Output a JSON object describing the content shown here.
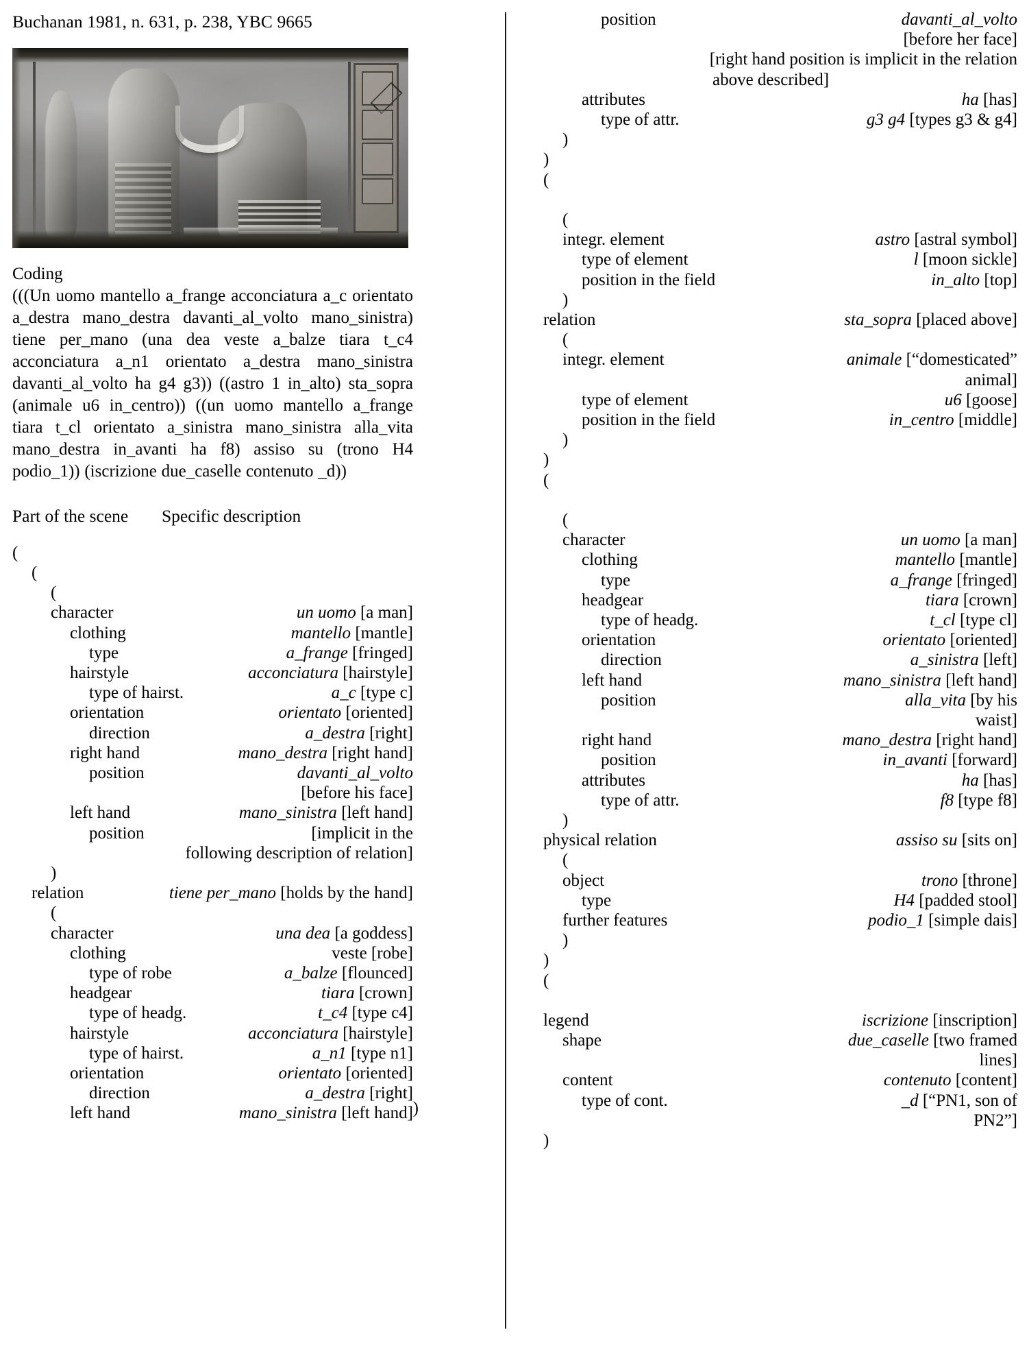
{
  "caption": "Buchanan 1981, n. 631, p. 238, YBC 9665",
  "figure": {
    "name": "cylinder-seal-impression"
  },
  "coding": {
    "heading": "Coding",
    "text": "(((Un uomo mantello a_frange acconciatura a_c orientato a_destra mano_destra davanti_al_volto mano_sinistra) tiene per_mano (una dea veste a_balze tiara t_c4 acconciatura a_n1 orientato a_destra mano_sinistra davanti_al_volto ha g4 g3)) ((astro 1 in_alto) sta_sopra (animale u6 in_centro)) ((un uomo mantello a_frange tiara t_cl orientato a_sinistra mano_sinistra alla_vita mano_destra in_avanti ha f8) assiso su (trono H4 podio_1)) (iscrizione due_caselle contenuto _d))"
  },
  "table_headers": {
    "part_of_scene": "Part of the scene",
    "specific_description": "Specific description"
  },
  "left_tree": [
    {
      "kind": "paren",
      "indent": 0,
      "text": "("
    },
    {
      "kind": "paren",
      "indent": 1,
      "text": "("
    },
    {
      "kind": "paren",
      "indent": 2,
      "text": "("
    },
    {
      "kind": "row",
      "indent": 2,
      "label": "character",
      "italic": "un uomo",
      "gloss": "[a man]"
    },
    {
      "kind": "row",
      "indent": 3,
      "label": "clothing",
      "italic": "mantello",
      "gloss": "[mantle]"
    },
    {
      "kind": "row",
      "indent": 4,
      "label": "type",
      "italic": "a_frange",
      "gloss": "[fringed]"
    },
    {
      "kind": "row",
      "indent": 3,
      "label": "hairstyle",
      "italic": "acconciatura",
      "gloss": "[hairstyle]"
    },
    {
      "kind": "row",
      "indent": 4,
      "label": "type of hairst.",
      "italic": "a_c",
      "gloss": "[type c]"
    },
    {
      "kind": "row",
      "indent": 3,
      "label": "orientation",
      "italic": "orientato",
      "gloss": "[oriented]"
    },
    {
      "kind": "row",
      "indent": 4,
      "label": "direction",
      "italic": "a_destra",
      "gloss": "[right]"
    },
    {
      "kind": "row",
      "indent": 3,
      "label": "right hand",
      "italic": "mano_destra",
      "gloss": "[right hand]"
    },
    {
      "kind": "row",
      "indent": 4,
      "label": "position",
      "italic": "davanti_al_volto",
      "gloss": ""
    },
    {
      "kind": "cont",
      "text": "[before his face]"
    },
    {
      "kind": "row",
      "indent": 3,
      "label": "left hand",
      "italic": "mano_sinistra",
      "gloss": "[left hand]"
    },
    {
      "kind": "row",
      "indent": 4,
      "label": "position",
      "italic": "",
      "gloss": "[implicit in the"
    },
    {
      "kind": "cont",
      "text": "following description of relation]"
    },
    {
      "kind": "paren",
      "indent": 2,
      "text": ")"
    },
    {
      "kind": "row",
      "indent": 1,
      "label": "relation",
      "italic": "tiene per_mano",
      "gloss": "[holds by the hand]"
    },
    {
      "kind": "paren",
      "indent": 2,
      "text": "("
    },
    {
      "kind": "row",
      "indent": 2,
      "label": "character",
      "italic": "una dea",
      "gloss": "[a goddess]"
    },
    {
      "kind": "row",
      "indent": 3,
      "label": "clothing",
      "italic": "",
      "gloss": "veste [robe]"
    },
    {
      "kind": "row",
      "indent": 4,
      "label": "type of robe",
      "italic": "a_balze",
      "gloss": "[flounced]"
    },
    {
      "kind": "row",
      "indent": 3,
      "label": "headgear",
      "italic": "tiara",
      "gloss": "[crown]"
    },
    {
      "kind": "row",
      "indent": 4,
      "label": "type of headg.",
      "italic": "t_c4",
      "gloss": "[type c4]"
    },
    {
      "kind": "row",
      "indent": 3,
      "label": "hairstyle",
      "italic": "acconciatura",
      "gloss": "[hairstyle]"
    },
    {
      "kind": "row",
      "indent": 4,
      "label": "type of hairst.",
      "italic": "a_n1",
      "gloss": "[type n1]"
    },
    {
      "kind": "row",
      "indent": 3,
      "label": "orientation",
      "italic": "orientato",
      "gloss": "[oriented]"
    },
    {
      "kind": "row",
      "indent": 4,
      "label": "direction",
      "italic": "a_destra",
      "gloss": "[right]"
    },
    {
      "kind": "row",
      "indent": 3,
      "label": "left hand",
      "italic": "mano_sinistra",
      "gloss": "[left hand]"
    }
  ],
  "left_tail_paren": ")",
  "right_tree": [
    {
      "kind": "row",
      "indent": 4,
      "label": "position",
      "italic": "davanti_al_volto",
      "gloss": ""
    },
    {
      "kind": "cont",
      "text": "[before her face]"
    },
    {
      "kind": "cont2",
      "line1": "[right hand position is implicit in the relation",
      "line2": "above described]"
    },
    {
      "kind": "row",
      "indent": 3,
      "label": "attributes",
      "italic": "ha",
      "gloss": "[has]"
    },
    {
      "kind": "row",
      "indent": 4,
      "label": "type of attr.",
      "italic": "g3 g4",
      "gloss": "[types g3 & g4]"
    },
    {
      "kind": "paren",
      "indent": 2,
      "text": ")"
    },
    {
      "kind": "paren",
      "indent": 1,
      "text": ")"
    },
    {
      "kind": "paren",
      "indent": 1,
      "text": "("
    },
    {
      "kind": "blank"
    },
    {
      "kind": "paren",
      "indent": 2,
      "text": "("
    },
    {
      "kind": "row",
      "indent": 2,
      "label": "integr. element",
      "italic": "astro",
      "gloss": "[astral symbol]"
    },
    {
      "kind": "row",
      "indent": 3,
      "label": "type of element",
      "italic": "l",
      "gloss": "[moon sickle]"
    },
    {
      "kind": "row",
      "indent": 3,
      "label": "position in the field",
      "italic": "in_alto",
      "gloss": "[top]"
    },
    {
      "kind": "paren",
      "indent": 2,
      "text": ")"
    },
    {
      "kind": "row",
      "indent": 1,
      "label": "relation",
      "italic": "sta_sopra",
      "gloss": "[placed above]"
    },
    {
      "kind": "paren",
      "indent": 2,
      "text": "("
    },
    {
      "kind": "row",
      "indent": 2,
      "label": "integr. element",
      "italic": "animale",
      "gloss": "[“domesticated”"
    },
    {
      "kind": "cont",
      "text": "animal]"
    },
    {
      "kind": "row",
      "indent": 3,
      "label": "type of element",
      "italic": "u6",
      "gloss": "[goose]"
    },
    {
      "kind": "row",
      "indent": 3,
      "label": "position in the field",
      "italic": "in_centro",
      "gloss": "[middle]"
    },
    {
      "kind": "paren",
      "indent": 2,
      "text": ")"
    },
    {
      "kind": "paren",
      "indent": 1,
      "text": ")"
    },
    {
      "kind": "paren",
      "indent": 1,
      "text": "("
    },
    {
      "kind": "blank"
    },
    {
      "kind": "paren",
      "indent": 2,
      "text": "("
    },
    {
      "kind": "row",
      "indent": 2,
      "label": "character",
      "italic": "un uomo",
      "gloss": "[a man]"
    },
    {
      "kind": "row",
      "indent": 3,
      "label": "clothing",
      "italic": "mantello",
      "gloss": "[mantle]"
    },
    {
      "kind": "row",
      "indent": 4,
      "label": "type",
      "italic": "a_frange",
      "gloss": "[fringed]"
    },
    {
      "kind": "row",
      "indent": 3,
      "label": "headgear",
      "italic": "tiara",
      "gloss": "[crown]"
    },
    {
      "kind": "row",
      "indent": 4,
      "label": "type of headg.",
      "italic": "t_cl",
      "gloss": "[type cl]"
    },
    {
      "kind": "row",
      "indent": 3,
      "label": "orientation",
      "italic": "orientato",
      "gloss": "[oriented]"
    },
    {
      "kind": "row",
      "indent": 4,
      "label": "direction",
      "italic": "a_sinistra",
      "gloss": "[left]"
    },
    {
      "kind": "row",
      "indent": 3,
      "label": "left hand",
      "italic": "mano_sinistra",
      "gloss": "[left hand]"
    },
    {
      "kind": "row",
      "indent": 4,
      "label": "position",
      "italic": "alla_vita",
      "gloss": "[by his"
    },
    {
      "kind": "cont",
      "text": "waist]"
    },
    {
      "kind": "row",
      "indent": 3,
      "label": "right hand",
      "italic": "mano_destra",
      "gloss": "[right hand]"
    },
    {
      "kind": "row",
      "indent": 4,
      "label": "position",
      "italic": "in_avanti",
      "gloss": "[forward]"
    },
    {
      "kind": "row",
      "indent": 3,
      "label": "attributes",
      "italic": "ha",
      "gloss": "[has]"
    },
    {
      "kind": "row",
      "indent": 4,
      "label": "type of attr.",
      "italic": "f8",
      "gloss": "[type f8]"
    },
    {
      "kind": "paren",
      "indent": 2,
      "text": ")"
    },
    {
      "kind": "row",
      "indent": 1,
      "label": "physical relation",
      "italic": "assiso su",
      "gloss": "[sits on]"
    },
    {
      "kind": "paren",
      "indent": 2,
      "text": "("
    },
    {
      "kind": "row",
      "indent": 2,
      "label": "object",
      "italic": "trono",
      "gloss": "[throne]"
    },
    {
      "kind": "row",
      "indent": 3,
      "label": "type",
      "italic": "H4",
      "gloss": "[padded stool]"
    },
    {
      "kind": "row",
      "indent": 2,
      "label": "further features",
      "italic": "podio_1",
      "gloss": "[simple dais]"
    },
    {
      "kind": "paren",
      "indent": 2,
      "text": ")"
    },
    {
      "kind": "paren",
      "indent": 1,
      "text": ")"
    },
    {
      "kind": "paren",
      "indent": 1,
      "text": "("
    },
    {
      "kind": "blank"
    },
    {
      "kind": "row",
      "indent": 1,
      "label": "legend",
      "italic": "iscrizione",
      "gloss": "[inscription]"
    },
    {
      "kind": "row",
      "indent": 2,
      "label": "shape",
      "italic": "due_caselle",
      "gloss": "[two framed"
    },
    {
      "kind": "cont",
      "text": "lines]"
    },
    {
      "kind": "row",
      "indent": 2,
      "label": "content",
      "italic": "contenuto",
      "gloss": "[content]"
    },
    {
      "kind": "row",
      "indent": 3,
      "label": "type of cont.",
      "italic": "_d",
      "gloss": "[“PN1, son of"
    },
    {
      "kind": "cont",
      "text": "PN2”]"
    },
    {
      "kind": "paren",
      "indent": 1,
      "text": ")"
    }
  ]
}
